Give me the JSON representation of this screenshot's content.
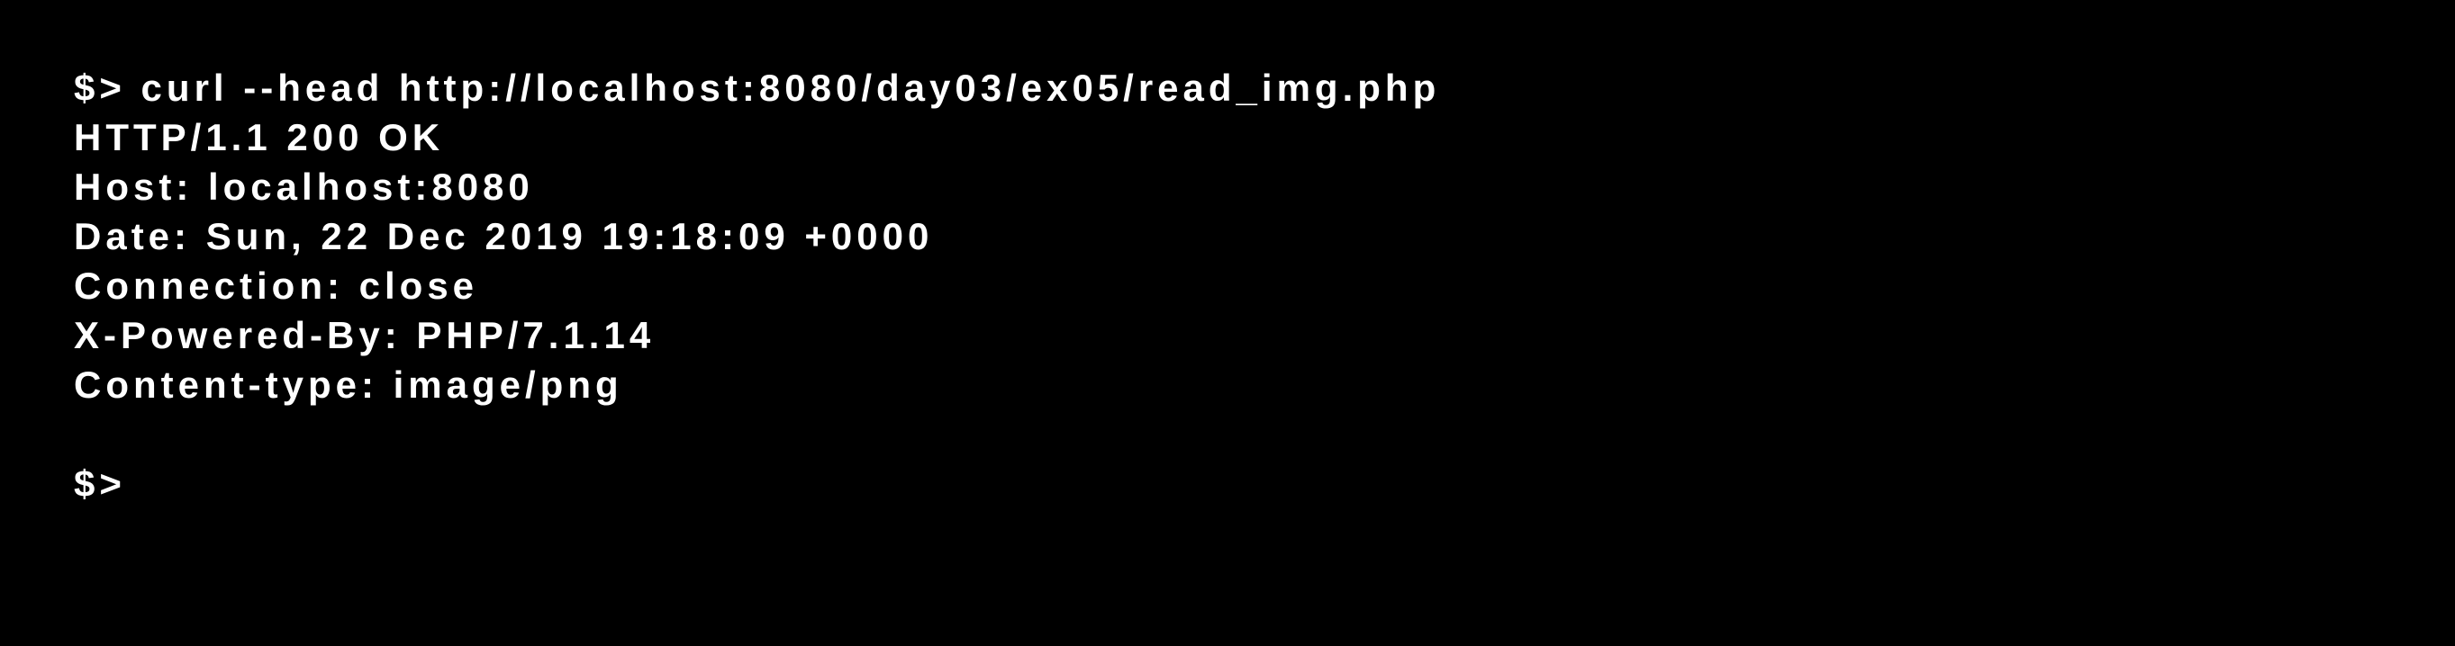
{
  "terminal": {
    "background": "#000000",
    "foreground": "#ffffff",
    "prompt": "$>",
    "command_line": "$> curl --head http://localhost:8080/day03/ex05/read_img.php",
    "response": {
      "status_line": "HTTP/1.1 200 OK",
      "host": "Host: localhost:8080",
      "date": "Date: Sun, 22 Dec 2019 19:18:09 +0000",
      "connection": "Connection: close",
      "x_powered_by": "X-Powered-By: PHP/7.1.14",
      "content_type": "Content-type: image/png"
    }
  }
}
